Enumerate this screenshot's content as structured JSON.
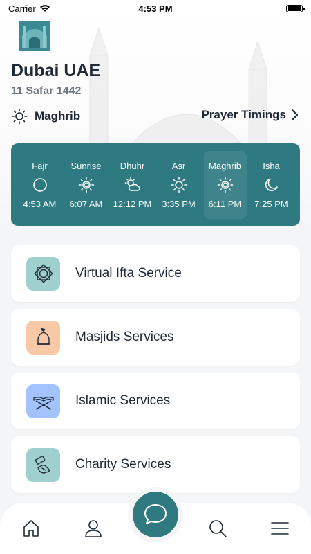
{
  "status_bar": {
    "carrier": "Carrier",
    "time": "4:53 PM"
  },
  "header": {
    "city": "Dubai UAE",
    "hijri_date": "11 Safar 1442",
    "current_prayer": "Maghrib",
    "timings_link": "Prayer Timings"
  },
  "prayers": [
    {
      "name": "Fajr",
      "time": "4:53 AM",
      "icon": "moon-circle-icon"
    },
    {
      "name": "Sunrise",
      "time": "6:07 AM",
      "icon": "sunrise-icon"
    },
    {
      "name": "Dhuhr",
      "time": "12:12 PM",
      "icon": "sun-cloud-icon"
    },
    {
      "name": "Asr",
      "time": "3:35 PM",
      "icon": "sun-icon"
    },
    {
      "name": "Maghrib",
      "time": "6:11 PM",
      "icon": "sunset-icon",
      "active": true
    },
    {
      "name": "Isha",
      "time": "7:25 PM",
      "icon": "crescent-moon-icon"
    }
  ],
  "services": [
    {
      "title": "Virtual Ifta Service",
      "icon": "star-octagon-icon",
      "color": "#9fcfcf"
    },
    {
      "title": "Masjids Services",
      "icon": "mosque-dome-icon",
      "color": "#f7c9a7"
    },
    {
      "title": "Islamic Services",
      "icon": "quran-stand-icon",
      "color": "#a3c3ff"
    },
    {
      "title": "Charity Services",
      "icon": "charity-hand-icon",
      "color": "#9fcfcf"
    }
  ],
  "colors": {
    "accent": "#2f7a80",
    "background": "#f3f5f7"
  },
  "bottom_nav": [
    "home-icon",
    "profile-icon",
    "chat-icon",
    "search-icon",
    "menu-icon"
  ]
}
